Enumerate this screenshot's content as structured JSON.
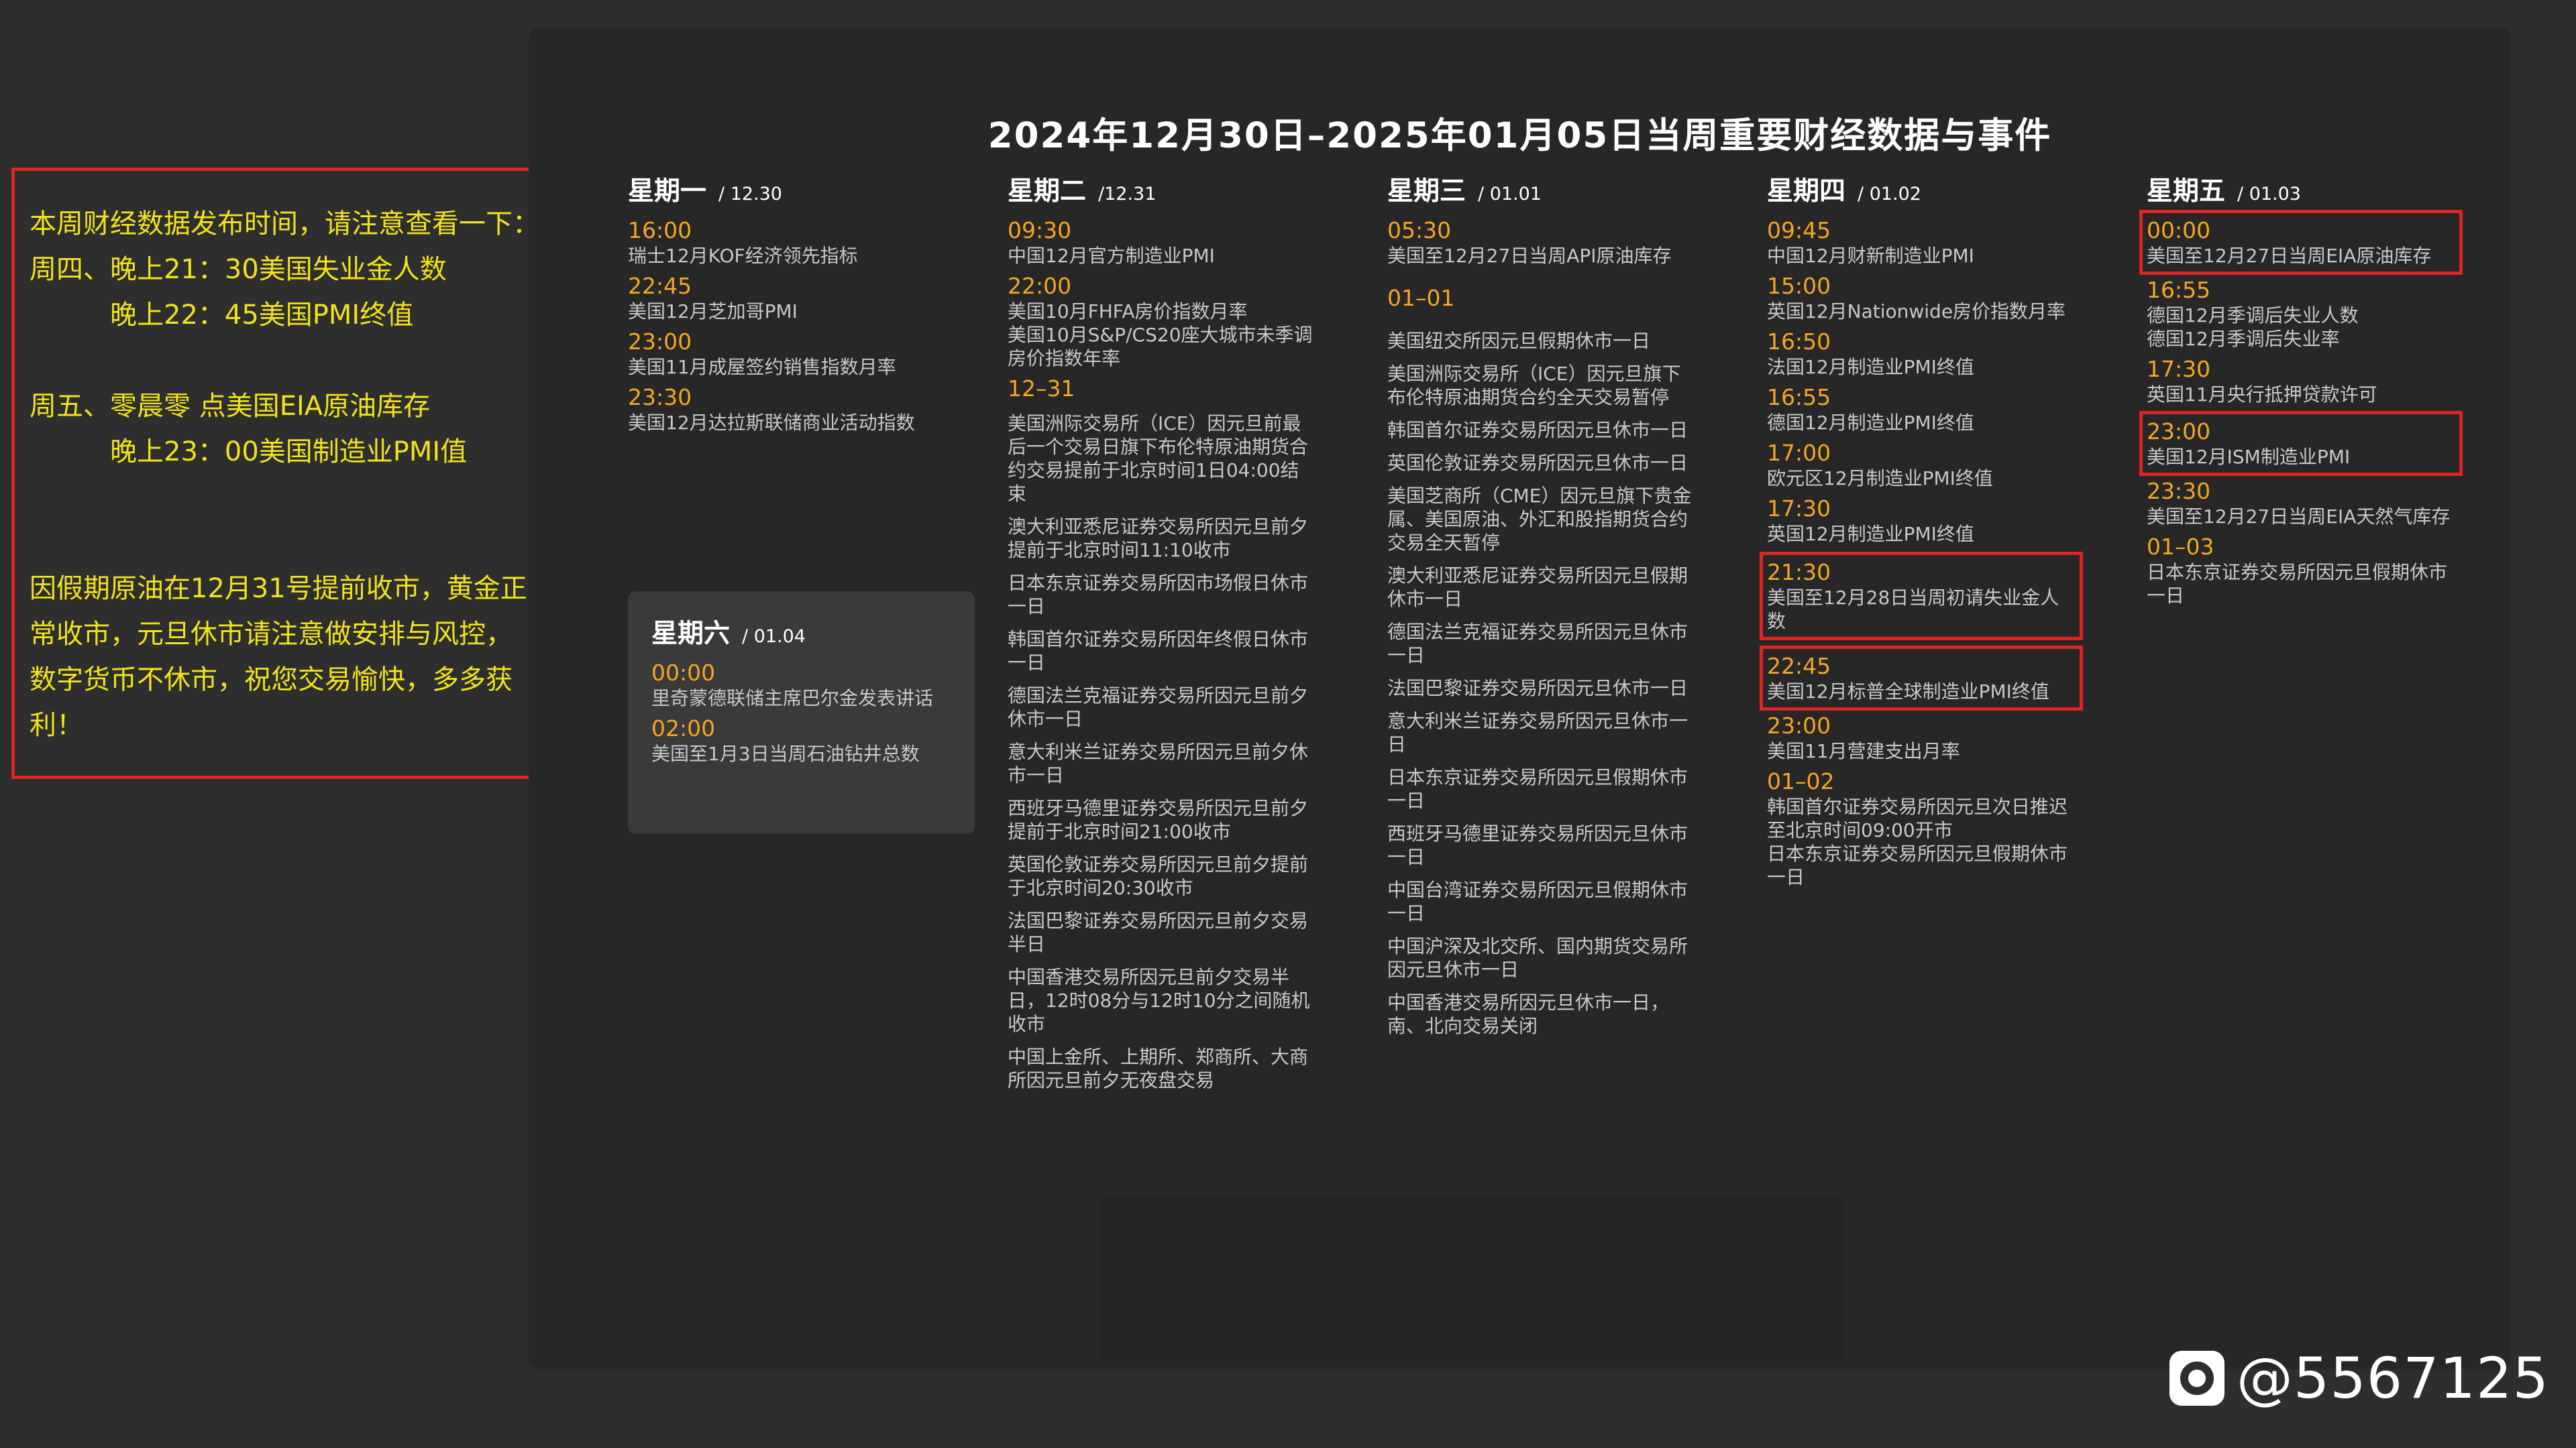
{
  "note": {
    "l1": "本周财经数据发布时间，请注意查看一下：",
    "l2": "周四、晚上21：30美国失业金人数",
    "l3": "晚上22：45美国PMI终值",
    "l4": "周五、零晨零 点美国EIA原油库存",
    "l5": "晚上23：00美国制造业PMI值",
    "l6": "因假期原油在12月31号提前收市，黄金正常收市，元旦休市请注意做安排与风控，数字货币不休市，祝您交易愉快，多多获利！"
  },
  "title": "2024年12月30日–2025年01月05日当周重要财经数据与事件",
  "days": {
    "mon": {
      "name": "星期一",
      "date": "/ 12.30",
      "events": [
        {
          "time": "16:00",
          "desc": "瑞士12月KOF经济领先指标"
        },
        {
          "time": "22:45",
          "desc": "美国12月芝加哥PMI"
        },
        {
          "time": "23:00",
          "desc": "美国11月成屋签约销售指数月率"
        },
        {
          "time": "23:30",
          "desc": "美国12月达拉斯联储商业活动指数"
        }
      ]
    },
    "tue": {
      "name": "星期二",
      "date": "/12.31",
      "events": [
        {
          "time": "09:30",
          "desc": "中国12月官方制造业PMI"
        },
        {
          "time": "22:00",
          "desc": "美国10月FHFA房价指数月率\n美国10月S&P/CS20座大城市未季调房价指数年率"
        }
      ],
      "block_time": "12–31",
      "block": [
        "美国洲际交易所（ICE）因元旦前最后一个交易日旗下布伦特原油期货合约交易提前于北京时间1日04:00结束",
        "澳大利亚悉尼证券交易所因元旦前夕提前于北京时间11:10收市",
        "日本东京证券交易所因市场假日休市一日",
        "韩国首尔证券交易所因年终假日休市一日",
        "德国法兰克福证券交易所因元旦前夕休市一日",
        "意大利米兰证券交易所因元旦前夕休市一日",
        "西班牙马德里证券交易所因元旦前夕提前于北京时间21:00收市",
        "英国伦敦证券交易所因元旦前夕提前于北京时间20:30收市",
        "法国巴黎证券交易所因元旦前夕交易半日",
        "中国香港交易所因元旦前夕交易半日，12时08分与12时10分之间随机收市",
        "中国上金所、上期所、郑商所、大商所因元旦前夕无夜盘交易"
      ]
    },
    "wed": {
      "name": "星期三",
      "date": "/ 01.01",
      "events": [
        {
          "time": "05:30",
          "desc": "美国至12月27日当周API原油库存"
        }
      ],
      "block_time": "01–01",
      "block": [
        "美国纽交所因元旦假期休市一日",
        "美国洲际交易所（ICE）因元旦旗下布伦特原油期货合约全天交易暂停",
        "韩国首尔证券交易所因元旦休市一日",
        "英国伦敦证券交易所因元旦休市一日",
        "美国芝商所（CME）因元旦旗下贵金属、美国原油、外汇和股指期货合约交易全天暂停",
        "澳大利亚悉尼证券交易所因元旦假期休市一日",
        "德国法兰克福证券交易所因元旦休市一日",
        "法国巴黎证券交易所因元旦休市一日",
        "意大利米兰证券交易所因元旦休市一日",
        "日本东京证券交易所因元旦假期休市一日",
        "西班牙马德里证券交易所因元旦休市一日",
        "中国台湾证券交易所因元旦假期休市一日",
        "中国沪深及北交所、国内期货交易所因元旦休市一日",
        "中国香港交易所因元旦休市一日，南、北向交易关闭"
      ]
    },
    "thu": {
      "name": "星期四",
      "date": "/ 01.02",
      "events": [
        {
          "time": "09:45",
          "desc": "中国12月财新制造业PMI"
        },
        {
          "time": "15:00",
          "desc": "英国12月Nationwide房价指数月率"
        },
        {
          "time": "16:50",
          "desc": "法国12月制造业PMI终值"
        },
        {
          "time": "16:55",
          "desc": "德国12月制造业PMI终值"
        },
        {
          "time": "17:00",
          "desc": "欧元区12月制造业PMI终值"
        },
        {
          "time": "17:30",
          "desc": "英国12月制造业PMI终值"
        },
        {
          "time": "21:30",
          "desc": "美国至12月28日当周初请失业金人数"
        },
        {
          "time": "22:45",
          "desc": "美国12月标普全球制造业PMI终值"
        },
        {
          "time": "23:00",
          "desc": "美国11月营建支出月率"
        },
        {
          "time": "01–02",
          "desc": "韩国首尔证券交易所因元旦次日推迟至北京时间09:00开市\n日本东京证券交易所因元旦假期休市一日"
        }
      ]
    },
    "fri": {
      "name": "星期五",
      "date": "/ 01.03",
      "events": [
        {
          "time": "00:00",
          "desc": "美国至12月27日当周EIA原油库存"
        },
        {
          "time": "16:55",
          "desc": "德国12月季调后失业人数\n德国12月季调后失业率"
        },
        {
          "time": "17:30",
          "desc": "英国11月央行抵押贷款许可"
        },
        {
          "time": "23:00",
          "desc": "美国12月ISM制造业PMI"
        },
        {
          "time": "23:30",
          "desc": "美国至12月27日当周EIA天然气库存"
        },
        {
          "time": "01–03",
          "desc": "日本东京证券交易所因元旦假期休市一日"
        }
      ]
    },
    "sat": {
      "name": "星期六",
      "date": "/ 01.04",
      "events": [
        {
          "time": "00:00",
          "desc": "里奇蒙德联储主席巴尔金发表讲话"
        },
        {
          "time": "02:00",
          "desc": "美国至1月3日当周石油钻井总数"
        }
      ]
    }
  },
  "watermark": "@5567125",
  "colors": {
    "accent_time": "#f5a623",
    "highlight_box": "#e02424",
    "note_text": "#f2e21b"
  }
}
